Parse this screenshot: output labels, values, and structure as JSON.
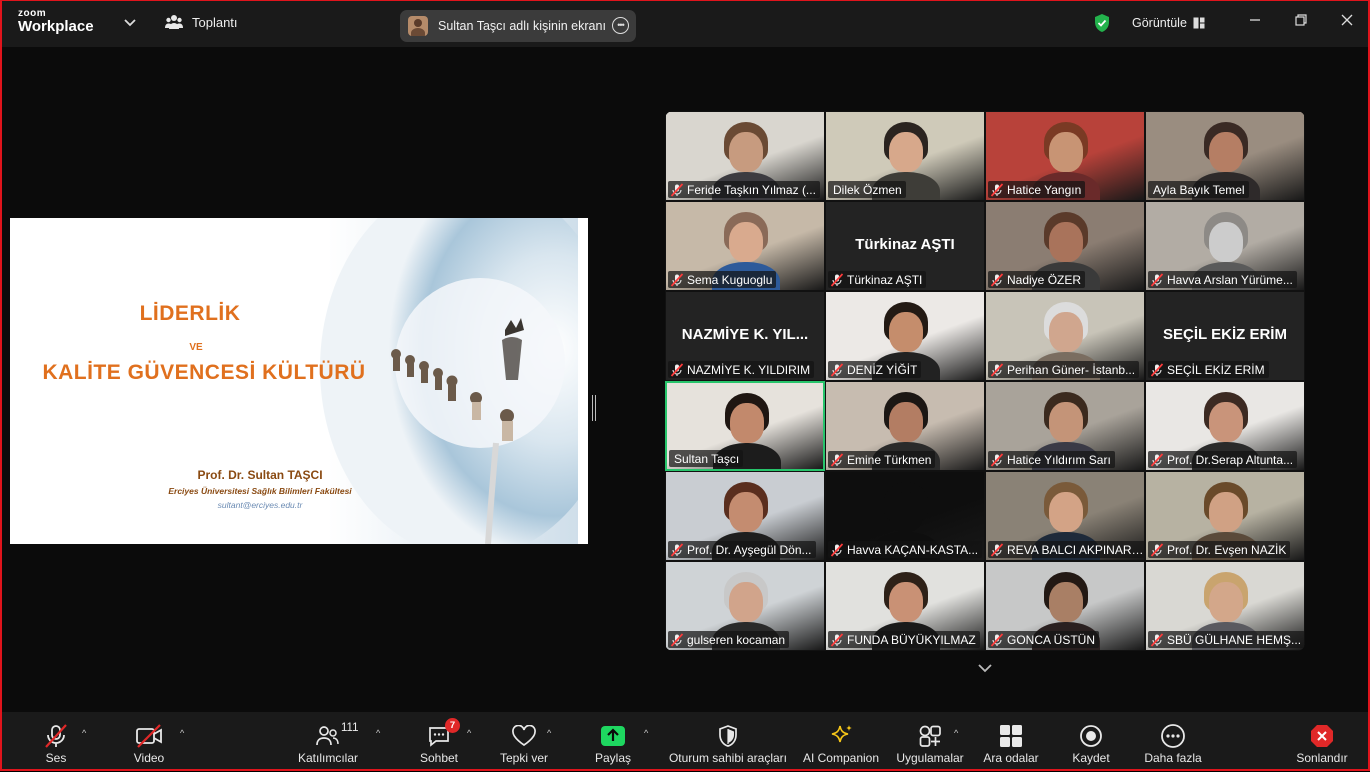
{
  "app": {
    "logo_line1": "zoom",
    "logo_line2": "Workplace"
  },
  "topbar": {
    "meeting_label": "Toplantı",
    "sharing_text": "Sultan Taşcı adlı kişinin ekranı",
    "view_label": "Görüntüle"
  },
  "slide": {
    "title1": "LİDERLİK",
    "connector": "VE",
    "title2": "KALİTE GÜVENCESİ KÜLTÜRÜ",
    "author": "Prof. Dr. Sultan TAŞCI",
    "institution": "Erciyes Üniversitesi Sağlık Bilimleri Fakültesi",
    "email": "sultant@erciyes.edu.tr"
  },
  "participants": [
    {
      "name": "Feride Taşkın Yılmaz (...",
      "muted": true
    },
    {
      "name": "Dilek Özmen",
      "muted": false
    },
    {
      "name": "Hatice Yangın",
      "muted": true
    },
    {
      "name": "Ayla Bayık Temel",
      "muted": false
    },
    {
      "name": "Sema Kuguoglu",
      "muted": true
    },
    {
      "name": "Türkinaz AŞTI",
      "display": "Türkinaz AŞTI",
      "muted": true
    },
    {
      "name": "Nadiye ÖZER",
      "muted": true
    },
    {
      "name": "Havva Arslan Yürüme...",
      "muted": true
    },
    {
      "name": "NAZMİYE K. YILDIRIM",
      "display": "NAZMİYE K. YIL...",
      "muted": true
    },
    {
      "name": "DENİZ YİĞİT",
      "muted": true
    },
    {
      "name": "Perihan Güner- İstanb...",
      "muted": true
    },
    {
      "name": "SEÇİL EKİZ ERİM",
      "display": "SEÇİL EKİZ ERİM",
      "muted": true
    },
    {
      "name": "Sultan Taşcı",
      "muted": false,
      "speaking": true
    },
    {
      "name": "Emine Türkmen",
      "muted": true
    },
    {
      "name": "Hatice Yıldırım Sarı",
      "muted": true
    },
    {
      "name": "Prof. Dr.Serap Altunta...",
      "muted": true
    },
    {
      "name": "Prof. Dr. Ayşegül Dön...",
      "muted": true
    },
    {
      "name": "Havva KAÇAN-KASTA...",
      "muted": true
    },
    {
      "name": "REVA BALCI AKPINAR ...",
      "muted": true
    },
    {
      "name": "Prof. Dr. Evşen NAZİK",
      "muted": true
    },
    {
      "name": "gulseren kocaman",
      "muted": true
    },
    {
      "name": "FUNDA BÜYÜKYILMAZ",
      "muted": true
    },
    {
      "name": "GONCA ÜSTÜN",
      "muted": true
    },
    {
      "name": "SBÜ GÜLHANE HEMŞ...",
      "muted": true
    }
  ],
  "toolbar": {
    "audio": "Ses",
    "video": "Video",
    "participants": "Katılımcılar",
    "participants_count": "111",
    "chat": "Sohbet",
    "chat_badge": "7",
    "react": "Tepki ver",
    "share": "Paylaş",
    "host_tools": "Oturum sahibi araçları",
    "ai": "AI Companion",
    "apps": "Uygulamalar",
    "breakout": "Ara odalar",
    "record": "Kaydet",
    "more": "Daha fazla",
    "end": "Sonlandır"
  },
  "colors": {
    "accent_green": "#27c46b",
    "share_green": "#1ed760",
    "end_red": "#e02828",
    "title_orange": "#e0701e"
  }
}
